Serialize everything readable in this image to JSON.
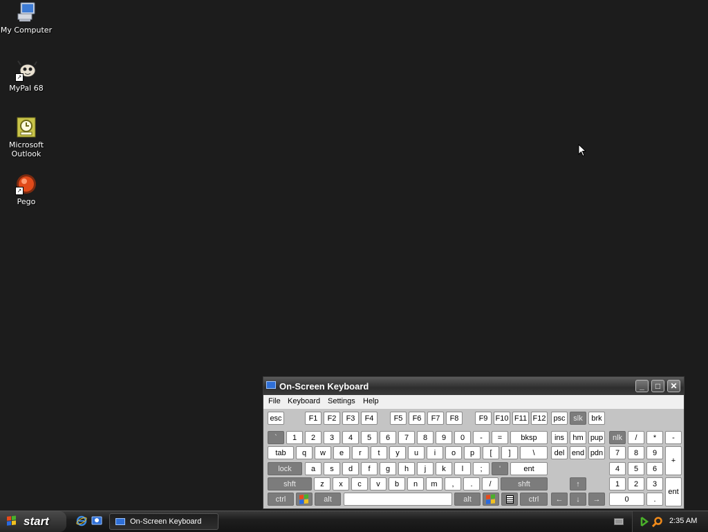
{
  "desktop": {
    "icons": [
      {
        "label": "My Computer",
        "icon": "computer-icon"
      },
      {
        "label": "MyPal 68",
        "icon": "mypal-icon"
      },
      {
        "label": "Microsoft Outlook",
        "icon": "outlook-icon"
      },
      {
        "label": "Pego",
        "icon": "pego-icon"
      }
    ]
  },
  "osk": {
    "title": "On-Screen Keyboard",
    "menu": [
      "File",
      "Keyboard",
      "Settings",
      "Help"
    ],
    "title_buttons": {
      "minimize": "_",
      "maximize": "□",
      "close": "✕"
    },
    "keys": {
      "esc": "esc",
      "f": [
        "F1",
        "F2",
        "F3",
        "F4",
        "F5",
        "F6",
        "F7",
        "F8",
        "F9",
        "F10",
        "F11",
        "F12"
      ],
      "psc": "psc",
      "slk": "slk",
      "brk": "brk",
      "num_row": [
        "`",
        "1",
        "2",
        "3",
        "4",
        "5",
        "6",
        "7",
        "8",
        "9",
        "0",
        "-",
        "="
      ],
      "bksp": "bksp",
      "ins": "ins",
      "hm": "hm",
      "pup": "pup",
      "nlk": "nlk",
      "np_div": "/",
      "np_mul": "*",
      "np_sub": "-",
      "tab": "tab",
      "q_row": [
        "q",
        "w",
        "e",
        "r",
        "t",
        "y",
        "u",
        "i",
        "o",
        "p",
        "[",
        "]",
        "\\"
      ],
      "del": "del",
      "end": "end",
      "pdn": "pdn",
      "np7": "7",
      "np8": "8",
      "np9": "9",
      "np_add": "+",
      "lock": "lock",
      "a_row": [
        "a",
        "s",
        "d",
        "f",
        "g",
        "h",
        "j",
        "k",
        "l",
        ";",
        "'"
      ],
      "ent": "ent",
      "np4": "4",
      "np5": "5",
      "np6": "6",
      "shft": "shft",
      "z_row": [
        "z",
        "x",
        "c",
        "v",
        "b",
        "n",
        "m",
        ",",
        ".",
        "/"
      ],
      "up": "↑",
      "np1": "1",
      "np2": "2",
      "np3": "3",
      "np_ent": "ent",
      "ctrl": "ctrl",
      "alt": "alt",
      "left": "←",
      "down": "↓",
      "right": "→",
      "np0": "0",
      "np_dot": "."
    }
  },
  "taskbar": {
    "start_label": "start",
    "task_label": "On-Screen Keyboard",
    "clock": "2:35 AM"
  },
  "colors": {
    "desktop": "#1c1c1c",
    "key": "#ffffff",
    "key_dark": "#7c7c7c"
  }
}
